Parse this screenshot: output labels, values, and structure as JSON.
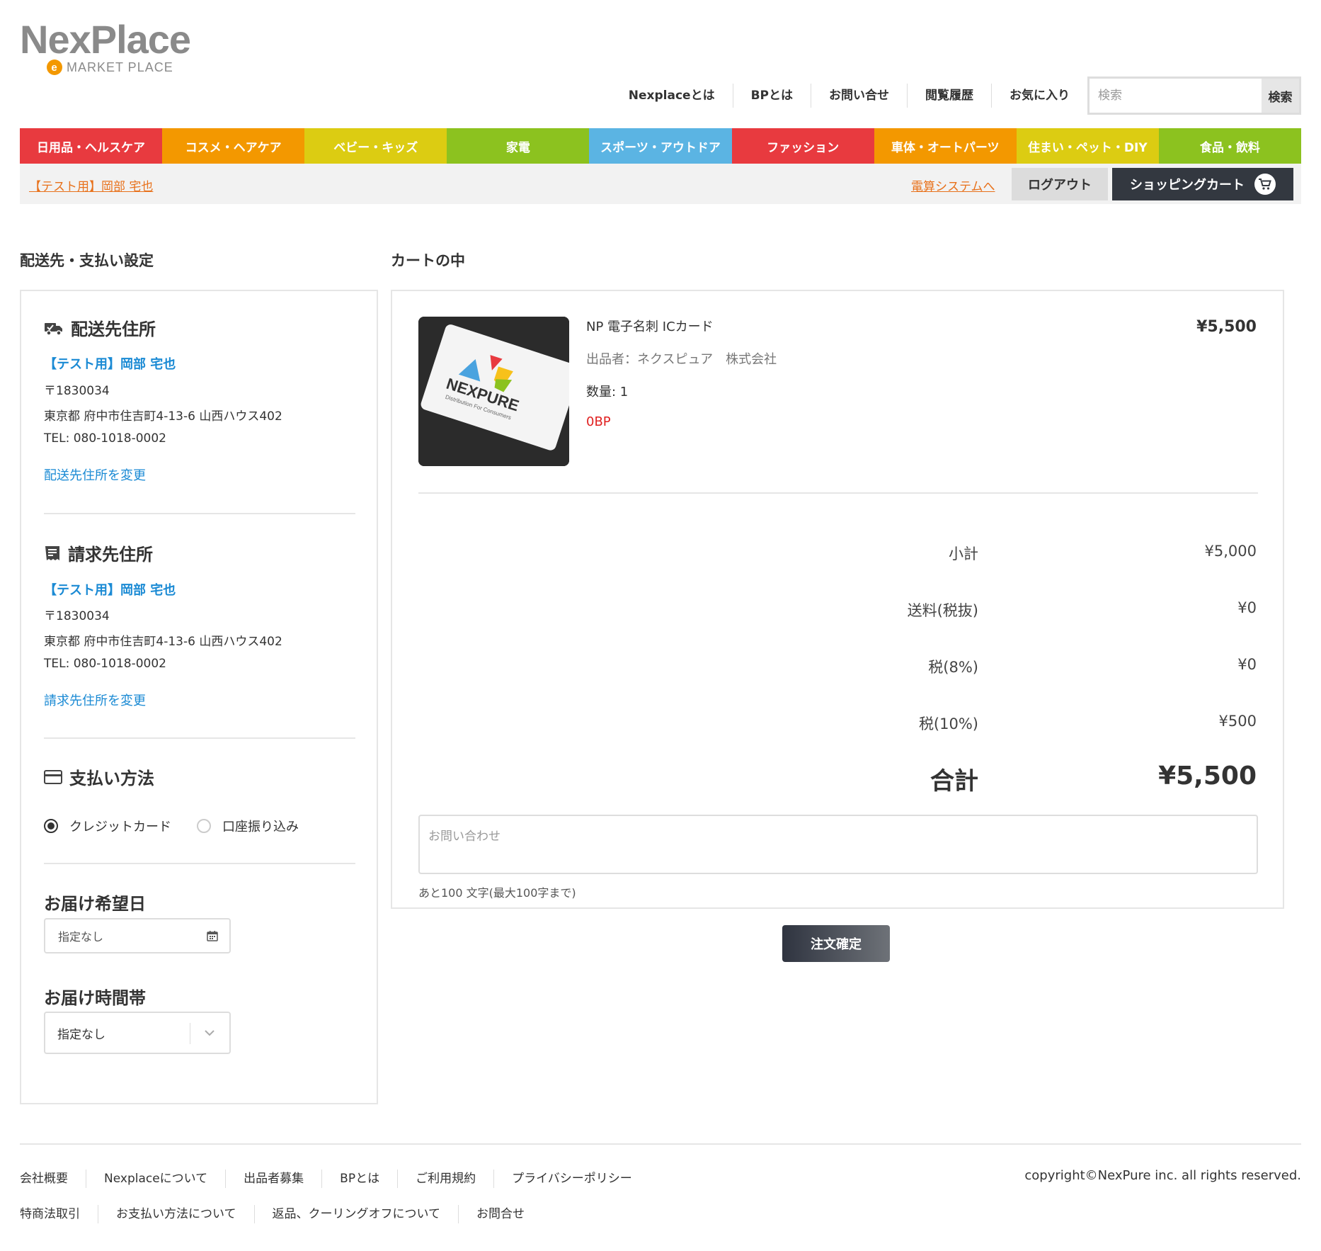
{
  "header": {
    "logo_main": "NexPlace",
    "logo_sub": "MARKET PLACE",
    "logo_badge": "e",
    "nav": [
      "Nexplaceとは",
      "BPとは",
      "お問い合せ",
      "閲覧履歴",
      "お気に入り"
    ],
    "search": {
      "placeholder": "検索",
      "button": "検索"
    }
  },
  "categories": [
    {
      "label": "日用品・ヘルスケア",
      "color": "#e83a3f"
    },
    {
      "label": "コスメ・ヘアケア",
      "color": "#f39800"
    },
    {
      "label": "ベビー・キッズ",
      "color": "#dccc12"
    },
    {
      "label": "家電",
      "color": "#8cc21f"
    },
    {
      "label": "スポーツ・アウトドア",
      "color": "#5bb4e3"
    },
    {
      "label": "ファッション",
      "color": "#e83a3f"
    },
    {
      "label": "車体・オートパーツ",
      "color": "#f39800"
    },
    {
      "label": "住まい・ペット・DIY",
      "color": "#dccc12"
    },
    {
      "label": "食品・飲料",
      "color": "#8cc21f"
    }
  ],
  "subbar": {
    "user_link": "【テスト用】岡部 宅也",
    "denzan_link": "電算システムへ",
    "logout": "ログアウト",
    "cart": "ショッピングカート"
  },
  "left": {
    "title": "配送先・支払い設定",
    "shipping": {
      "heading": "配送先住所",
      "name": "【テスト用】岡部 宅也",
      "postal": "〒1830034",
      "address": "東京都 府中市住吉町4-13-6 山西ハウス402",
      "tel": "TEL: 080-1018-0002",
      "change": "配送先住所を変更"
    },
    "billing": {
      "heading": "請求先住所",
      "name": "【テスト用】岡部 宅也",
      "postal": "〒1830034",
      "address": "東京都 府中市住吉町4-13-6 山西ハウス402",
      "tel": "TEL: 080-1018-0002",
      "change": "請求先住所を変更"
    },
    "payment": {
      "heading": "支払い方法",
      "options": [
        "クレジットカード",
        "口座振り込み"
      ],
      "selected": "クレジットカード"
    },
    "delivery_date": {
      "label": "お届け希望日",
      "value": "指定なし"
    },
    "delivery_time": {
      "label": "お届け時間帯",
      "value": "指定なし"
    }
  },
  "cart": {
    "title": "カートの中",
    "item": {
      "name": "NP 電子名刺 ICカード",
      "seller": "出品者：ネクスピュア　株式会社",
      "qty": "数量: 1",
      "bp": "0BP",
      "price": "¥5,500",
      "image_text": "NEXPURE",
      "image_subtext": "Distribution For Consumers"
    },
    "summary": [
      {
        "label": "小計",
        "value": "¥5,000"
      },
      {
        "label": "送料(税抜)",
        "value": "¥0"
      },
      {
        "label": "税(8%)",
        "value": "¥0"
      },
      {
        "label": "税(10%)",
        "value": "¥500"
      }
    ],
    "total": {
      "label": "合計",
      "value": "¥5,500"
    },
    "inquiry_placeholder": "お問い合わせ",
    "char_count": "あと100 文字(最大100字まで)",
    "confirm": "注文確定"
  },
  "footer": {
    "row1": [
      "会社概要",
      "Nexplaceについて",
      "出品者募集",
      "BPとは",
      "ご利用規約",
      "プライバシーポリシー"
    ],
    "row2": [
      "特商法取引",
      "お支払い方法について",
      "返品、クーリングオフについて",
      "お問合せ"
    ],
    "copyright": "copyright©NexPure inc. all rights reserved."
  }
}
